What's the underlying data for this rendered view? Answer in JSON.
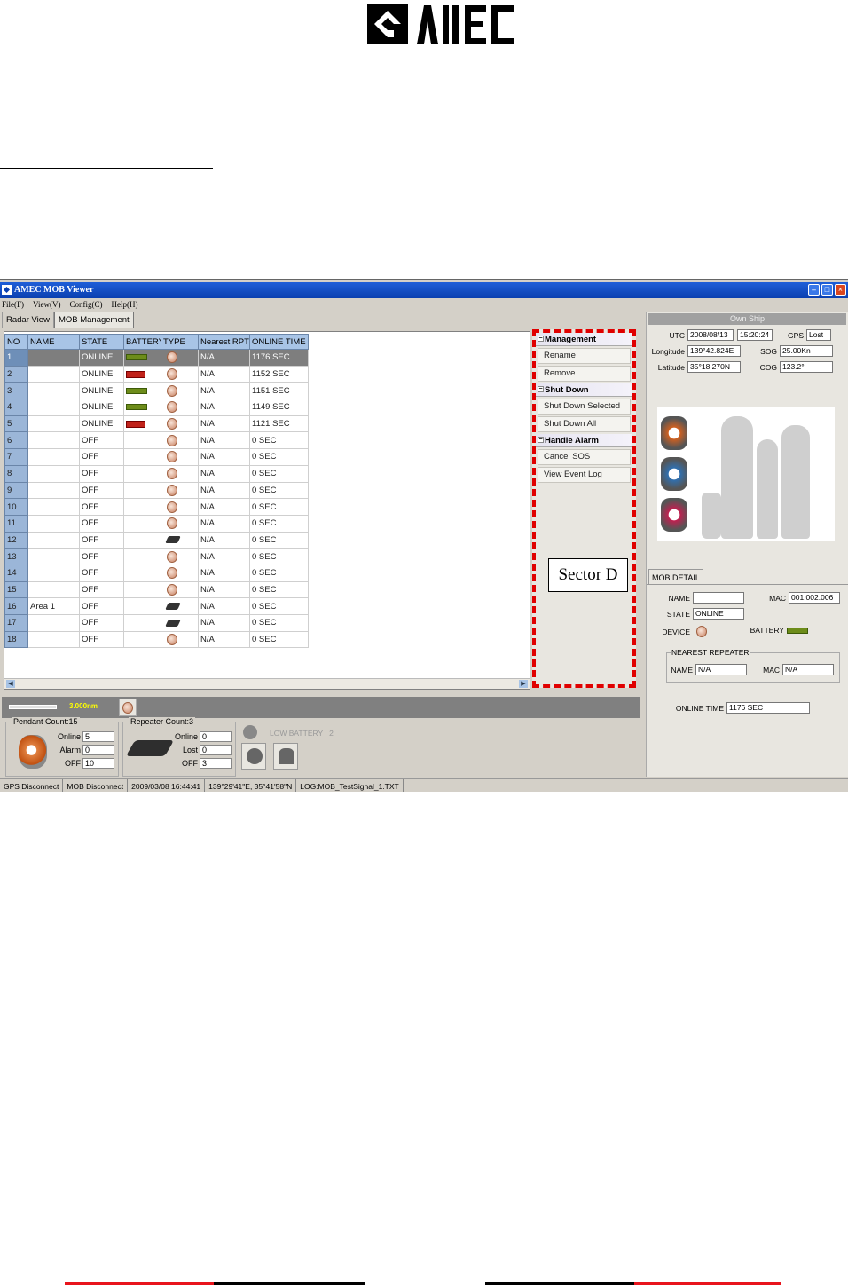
{
  "logo": {
    "text": "AMEC"
  },
  "window": {
    "title": "AMEC MOB Viewer",
    "menu": [
      "File(F)",
      "View(V)",
      "Config(C)",
      "Help(H)"
    ],
    "tabs": [
      "Radar View",
      "MOB Management"
    ],
    "active_tab": "MOB Management"
  },
  "grid": {
    "columns": [
      "NO",
      "NAME",
      "STATE",
      "BATTERY",
      "TYPE",
      "Nearest RPT",
      "ONLINE TIME"
    ],
    "rows": [
      {
        "no": "1",
        "name": "",
        "state": "ONLINE",
        "battery": "ok",
        "type": "pendant",
        "rpt": "N/A",
        "time": "1176 SEC"
      },
      {
        "no": "2",
        "name": "",
        "state": "ONLINE",
        "battery": "low",
        "type": "pendant",
        "rpt": "N/A",
        "time": "1152 SEC"
      },
      {
        "no": "3",
        "name": "",
        "state": "ONLINE",
        "battery": "ok",
        "type": "pendant",
        "rpt": "N/A",
        "time": "1151 SEC"
      },
      {
        "no": "4",
        "name": "",
        "state": "ONLINE",
        "battery": "ok",
        "type": "pendant",
        "rpt": "N/A",
        "time": "1149 SEC"
      },
      {
        "no": "5",
        "name": "",
        "state": "ONLINE",
        "battery": "low",
        "type": "pendant",
        "rpt": "N/A",
        "time": "1121 SEC"
      },
      {
        "no": "6",
        "name": "",
        "state": "OFF",
        "battery": "",
        "type": "pendant",
        "rpt": "N/A",
        "time": "0 SEC"
      },
      {
        "no": "7",
        "name": "",
        "state": "OFF",
        "battery": "",
        "type": "pendant",
        "rpt": "N/A",
        "time": "0 SEC"
      },
      {
        "no": "8",
        "name": "",
        "state": "OFF",
        "battery": "",
        "type": "pendant",
        "rpt": "N/A",
        "time": "0 SEC"
      },
      {
        "no": "9",
        "name": "",
        "state": "OFF",
        "battery": "",
        "type": "pendant",
        "rpt": "N/A",
        "time": "0 SEC"
      },
      {
        "no": "10",
        "name": "",
        "state": "OFF",
        "battery": "",
        "type": "pendant",
        "rpt": "N/A",
        "time": "0 SEC"
      },
      {
        "no": "11",
        "name": "",
        "state": "OFF",
        "battery": "",
        "type": "pendant",
        "rpt": "N/A",
        "time": "0 SEC"
      },
      {
        "no": "12",
        "name": "",
        "state": "OFF",
        "battery": "",
        "type": "repeater",
        "rpt": "N/A",
        "time": "0 SEC"
      },
      {
        "no": "13",
        "name": "",
        "state": "OFF",
        "battery": "",
        "type": "pendant",
        "rpt": "N/A",
        "time": "0 SEC"
      },
      {
        "no": "14",
        "name": "",
        "state": "OFF",
        "battery": "",
        "type": "pendant",
        "rpt": "N/A",
        "time": "0 SEC"
      },
      {
        "no": "15",
        "name": "",
        "state": "OFF",
        "battery": "",
        "type": "pendant",
        "rpt": "N/A",
        "time": "0 SEC"
      },
      {
        "no": "16",
        "name": "Area 1",
        "state": "OFF",
        "battery": "",
        "type": "repeater",
        "rpt": "N/A",
        "time": "0 SEC"
      },
      {
        "no": "17",
        "name": "",
        "state": "OFF",
        "battery": "",
        "type": "repeater",
        "rpt": "N/A",
        "time": "0 SEC"
      },
      {
        "no": "18",
        "name": "",
        "state": "OFF",
        "battery": "",
        "type": "pendant",
        "rpt": "N/A",
        "time": "0 SEC"
      }
    ]
  },
  "actions": {
    "groups": [
      {
        "title": "Management",
        "items": [
          "Rename",
          "Remove"
        ]
      },
      {
        "title": "Shut Down",
        "items": [
          "Shut Down Selected",
          "Shut Down All"
        ]
      },
      {
        "title": "Handle Alarm",
        "items": [
          "Cancel SOS",
          "View Event Log"
        ]
      }
    ],
    "sector_label": "Sector D"
  },
  "strip": {
    "scale": "3.000nm"
  },
  "pendant_count": {
    "legend": "Pendant Count:15",
    "online_label": "Online",
    "online": "5",
    "alarm_label": "Alarm",
    "alarm": "0",
    "off_label": "OFF",
    "off": "10"
  },
  "repeater_count": {
    "legend": "Repeater Count:3",
    "online_label": "Online",
    "online": "0",
    "lost_label": "Lost",
    "lost": "0",
    "off_label": "OFF",
    "off": "3"
  },
  "low_battery": "LOW BATTERY : 2",
  "own_ship": {
    "title": "Own Ship",
    "utc_label": "UTC",
    "utc_date": "2008/08/13",
    "utc_time": "15:20:24",
    "gps_label": "GPS",
    "gps": "Lost",
    "lon_label": "Longitude",
    "lon": "139°42.824E",
    "sog_label": "SOG",
    "sog": "25.00Kn",
    "lat_label": "Latitude",
    "lat": "35°18.270N",
    "cog_label": "COG",
    "cog": "123.2°"
  },
  "mob_detail": {
    "tab": "MOB DETAIL",
    "name_label": "NAME",
    "name": "",
    "mac_label": "MAC",
    "mac": "001.002.006",
    "state_label": "STATE",
    "state": "ONLINE",
    "device_label": "DEVICE",
    "battery_label": "BATTERY",
    "repeater_legend": "NEAREST REPEATER",
    "rpt_name_label": "NAME",
    "rpt_name": "N/A",
    "rpt_mac_label": "MAC",
    "rpt_mac": "N/A",
    "online_time_label": "ONLINE TIME",
    "online_time": "1176 SEC"
  },
  "statusbar": [
    "GPS Disconnect",
    "MOB Disconnect",
    "2009/03/08 16:44:41",
    "139°29'41\"E, 35°41'58\"N",
    "LOG:MOB_TestSignal_1.TXT"
  ],
  "colors": {
    "accent_red": "#e00000",
    "title_blue": "#0a3fb0",
    "grid_header": "#a8c4e6"
  }
}
